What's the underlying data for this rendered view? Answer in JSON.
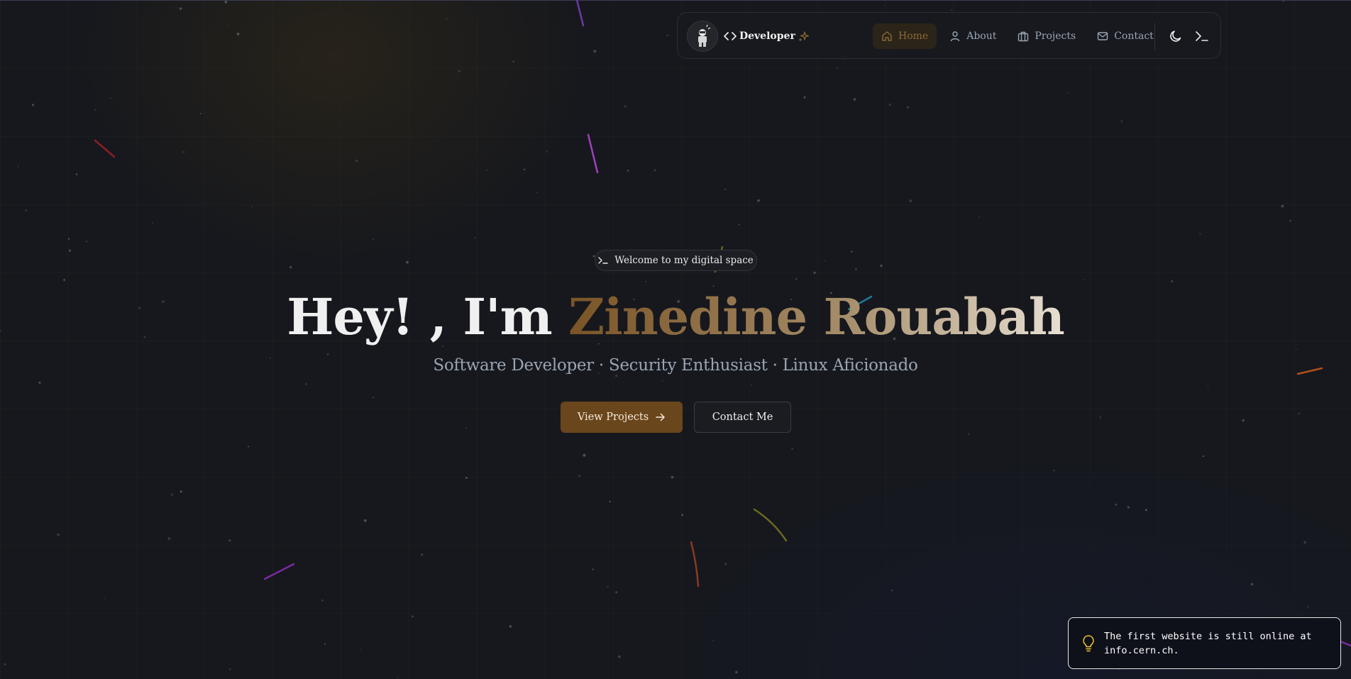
{
  "navbar": {
    "brand_label": "Developer",
    "brand_code_icon": "code-brackets-icon",
    "brand_sparkle_icon": "sparkles-icon",
    "items": [
      {
        "label": "Home",
        "icon": "home-icon",
        "active": true
      },
      {
        "label": "About",
        "icon": "user-icon",
        "active": false
      },
      {
        "label": "Projects",
        "icon": "briefcase-icon",
        "active": false
      },
      {
        "label": "Contact",
        "icon": "mail-icon",
        "active": false
      }
    ],
    "theme_toggle_icon": "moon-icon",
    "terminal_icon": "terminal-icon"
  },
  "hero": {
    "badge_text": "Welcome to my digital space",
    "title_prefix": "Hey! , I'm ",
    "title_name": "Zinedine Rouabah",
    "subtitle": "Software Developer · Security Enthusiast · Linux Aficionado",
    "primary_button": "View Projects",
    "secondary_button": "Contact Me"
  },
  "toast": {
    "icon": "lightbulb-icon",
    "text": "The first website is still online at info.cern.ch."
  },
  "colors": {
    "background": "#16181d",
    "accent": "#6a461d",
    "accent_text": "#8c6a36",
    "muted_text": "#9aa4b3",
    "toast_icon": "#f2c230"
  }
}
